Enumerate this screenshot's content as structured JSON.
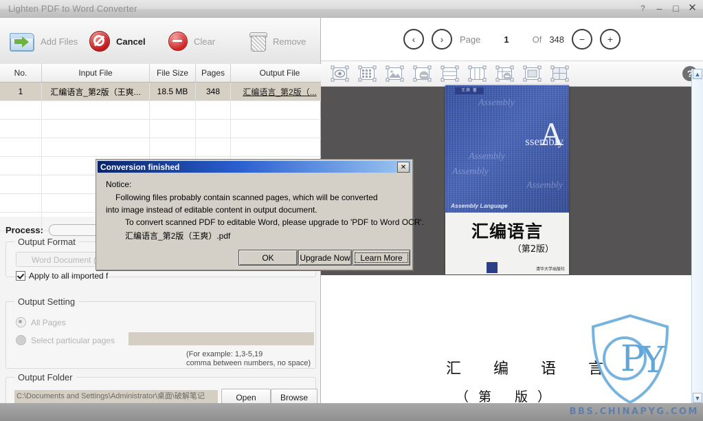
{
  "window": {
    "title": "Lighten PDF to Word Converter",
    "controls": {
      "help": "?",
      "minimize": "–",
      "maximize": "□",
      "close": "✕"
    }
  },
  "toolbar": {
    "add_files": "Add Files",
    "cancel": "Cancel",
    "clear": "Clear",
    "remove": "Remove"
  },
  "file_table": {
    "columns": [
      "No.",
      "Input File",
      "File Size",
      "Pages",
      "Output File"
    ],
    "rows": [
      {
        "no": "1",
        "input_file": "汇编语言_第2版（王爽...",
        "file_size": "18.5 MB",
        "pages": "348",
        "output_file": "汇编语言_第2版（..."
      }
    ]
  },
  "process": {
    "label": "Process:",
    "percent": 0
  },
  "output_format": {
    "group_title": "Output Format",
    "selected": "Word Document (.doc)",
    "apply_all_label": "Apply to all imported f",
    "apply_all_checked": true
  },
  "output_setting": {
    "group_title": "Output Setting",
    "all_pages_label": "All Pages",
    "all_pages_selected": true,
    "particular_label": "Select particular pages",
    "particular_selected": false,
    "pages_value": "",
    "hint_line1": "(For example: 1,3-5,19",
    "hint_line2": "comma between numbers, no space)"
  },
  "output_folder": {
    "group_title": "Output Folder",
    "path": "C:\\Documents and Settings\\Administrator\\桌面\\破解笔记",
    "open_label": "Open",
    "browse_label": "Browse"
  },
  "preview": {
    "prev_icon": "‹",
    "next_icon": "›",
    "page_label": "Page",
    "page_current": "1",
    "of_label": "Of",
    "page_total": "348",
    "zoom_out_icon": "−",
    "zoom_in_icon": "+",
    "help_icon": "?",
    "tool_icons": [
      "select-tool-icon",
      "grid-tool-icon",
      "image-tool-icon",
      "remove-image-tool-icon",
      "rows-tool-icon",
      "columns-tool-icon",
      "remove-table-tool-icon",
      "frame-tool-icon",
      "table-tool-icon"
    ],
    "cover": {
      "author_band": "王爽 著",
      "big_letter": "A",
      "big_word": "ssembly",
      "ghost_words": [
        "Assembly",
        "Assembly",
        "Assembly",
        "Assembly"
      ],
      "english_subtitle": "Assembly Language",
      "chinese_title": "汇编语言",
      "edition": "（第2版）",
      "publisher": "清华大学出版社"
    },
    "page2": {
      "title": "汇 编 语 言",
      "subtitle": "（第 版）"
    }
  },
  "watermark": {
    "text": "BBS.CHINAPYG.COM",
    "color": "#5f7fa8"
  },
  "dialog": {
    "title": "Conversion finished",
    "close_icon": "✕",
    "lines": [
      "Notice:",
      "Following files probably contain scanned pages, which will be converted",
      "into image instead of editable content in output document.",
      "To convert scanned PDF to editable Word, please upgrade to 'PDF to Word OCR'.",
      "汇编语言_第2版（王爽）.pdf"
    ],
    "ok_label": "OK",
    "upgrade_label": "Upgrade Now",
    "learn_label": "Learn More"
  },
  "colors": {
    "dialog_title_start": "#0a246a",
    "dialog_face": "#d4d0c8",
    "selection_row": "#d6cfc4",
    "preview_bg": "#555353",
    "watermark": "#5f7fa8"
  }
}
